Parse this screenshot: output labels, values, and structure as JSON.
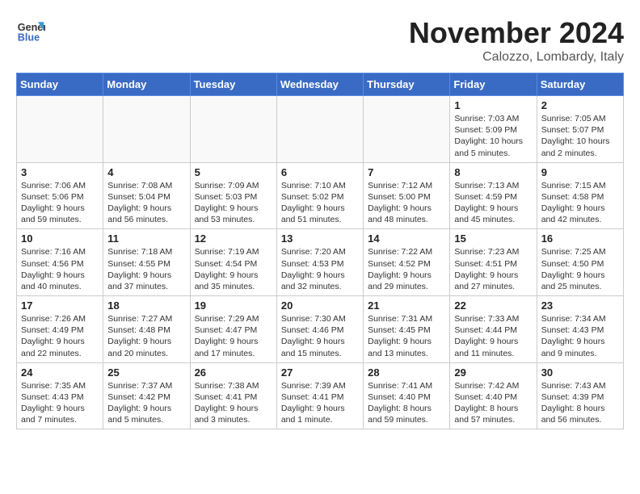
{
  "header": {
    "logo_line1": "General",
    "logo_line2": "Blue",
    "month": "November 2024",
    "location": "Calozzo, Lombardy, Italy"
  },
  "weekdays": [
    "Sunday",
    "Monday",
    "Tuesday",
    "Wednesday",
    "Thursday",
    "Friday",
    "Saturday"
  ],
  "weeks": [
    [
      {
        "day": "",
        "detail": ""
      },
      {
        "day": "",
        "detail": ""
      },
      {
        "day": "",
        "detail": ""
      },
      {
        "day": "",
        "detail": ""
      },
      {
        "day": "",
        "detail": ""
      },
      {
        "day": "1",
        "detail": "Sunrise: 7:03 AM\nSunset: 5:09 PM\nDaylight: 10 hours\nand 5 minutes."
      },
      {
        "day": "2",
        "detail": "Sunrise: 7:05 AM\nSunset: 5:07 PM\nDaylight: 10 hours\nand 2 minutes."
      }
    ],
    [
      {
        "day": "3",
        "detail": "Sunrise: 7:06 AM\nSunset: 5:06 PM\nDaylight: 9 hours\nand 59 minutes."
      },
      {
        "day": "4",
        "detail": "Sunrise: 7:08 AM\nSunset: 5:04 PM\nDaylight: 9 hours\nand 56 minutes."
      },
      {
        "day": "5",
        "detail": "Sunrise: 7:09 AM\nSunset: 5:03 PM\nDaylight: 9 hours\nand 53 minutes."
      },
      {
        "day": "6",
        "detail": "Sunrise: 7:10 AM\nSunset: 5:02 PM\nDaylight: 9 hours\nand 51 minutes."
      },
      {
        "day": "7",
        "detail": "Sunrise: 7:12 AM\nSunset: 5:00 PM\nDaylight: 9 hours\nand 48 minutes."
      },
      {
        "day": "8",
        "detail": "Sunrise: 7:13 AM\nSunset: 4:59 PM\nDaylight: 9 hours\nand 45 minutes."
      },
      {
        "day": "9",
        "detail": "Sunrise: 7:15 AM\nSunset: 4:58 PM\nDaylight: 9 hours\nand 42 minutes."
      }
    ],
    [
      {
        "day": "10",
        "detail": "Sunrise: 7:16 AM\nSunset: 4:56 PM\nDaylight: 9 hours\nand 40 minutes."
      },
      {
        "day": "11",
        "detail": "Sunrise: 7:18 AM\nSunset: 4:55 PM\nDaylight: 9 hours\nand 37 minutes."
      },
      {
        "day": "12",
        "detail": "Sunrise: 7:19 AM\nSunset: 4:54 PM\nDaylight: 9 hours\nand 35 minutes."
      },
      {
        "day": "13",
        "detail": "Sunrise: 7:20 AM\nSunset: 4:53 PM\nDaylight: 9 hours\nand 32 minutes."
      },
      {
        "day": "14",
        "detail": "Sunrise: 7:22 AM\nSunset: 4:52 PM\nDaylight: 9 hours\nand 29 minutes."
      },
      {
        "day": "15",
        "detail": "Sunrise: 7:23 AM\nSunset: 4:51 PM\nDaylight: 9 hours\nand 27 minutes."
      },
      {
        "day": "16",
        "detail": "Sunrise: 7:25 AM\nSunset: 4:50 PM\nDaylight: 9 hours\nand 25 minutes."
      }
    ],
    [
      {
        "day": "17",
        "detail": "Sunrise: 7:26 AM\nSunset: 4:49 PM\nDaylight: 9 hours\nand 22 minutes."
      },
      {
        "day": "18",
        "detail": "Sunrise: 7:27 AM\nSunset: 4:48 PM\nDaylight: 9 hours\nand 20 minutes."
      },
      {
        "day": "19",
        "detail": "Sunrise: 7:29 AM\nSunset: 4:47 PM\nDaylight: 9 hours\nand 17 minutes."
      },
      {
        "day": "20",
        "detail": "Sunrise: 7:30 AM\nSunset: 4:46 PM\nDaylight: 9 hours\nand 15 minutes."
      },
      {
        "day": "21",
        "detail": "Sunrise: 7:31 AM\nSunset: 4:45 PM\nDaylight: 9 hours\nand 13 minutes."
      },
      {
        "day": "22",
        "detail": "Sunrise: 7:33 AM\nSunset: 4:44 PM\nDaylight: 9 hours\nand 11 minutes."
      },
      {
        "day": "23",
        "detail": "Sunrise: 7:34 AM\nSunset: 4:43 PM\nDaylight: 9 hours\nand 9 minutes."
      }
    ],
    [
      {
        "day": "24",
        "detail": "Sunrise: 7:35 AM\nSunset: 4:43 PM\nDaylight: 9 hours\nand 7 minutes."
      },
      {
        "day": "25",
        "detail": "Sunrise: 7:37 AM\nSunset: 4:42 PM\nDaylight: 9 hours\nand 5 minutes."
      },
      {
        "day": "26",
        "detail": "Sunrise: 7:38 AM\nSunset: 4:41 PM\nDaylight: 9 hours\nand 3 minutes."
      },
      {
        "day": "27",
        "detail": "Sunrise: 7:39 AM\nSunset: 4:41 PM\nDaylight: 9 hours\nand 1 minute."
      },
      {
        "day": "28",
        "detail": "Sunrise: 7:41 AM\nSunset: 4:40 PM\nDaylight: 8 hours\nand 59 minutes."
      },
      {
        "day": "29",
        "detail": "Sunrise: 7:42 AM\nSunset: 4:40 PM\nDaylight: 8 hours\nand 57 minutes."
      },
      {
        "day": "30",
        "detail": "Sunrise: 7:43 AM\nSunset: 4:39 PM\nDaylight: 8 hours\nand 56 minutes."
      }
    ]
  ]
}
